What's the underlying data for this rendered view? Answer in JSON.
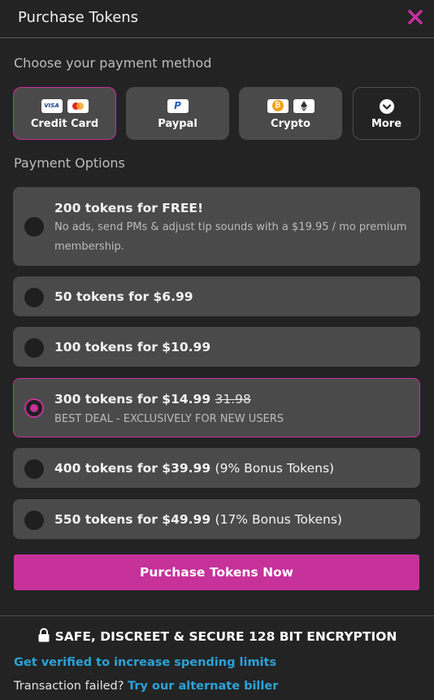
{
  "header": {
    "title": "Purchase Tokens",
    "close_icon": "close-icon"
  },
  "payment_method": {
    "label": "Choose your payment method",
    "methods": [
      {
        "label": "Credit Card",
        "icons": [
          "visa-icon",
          "mastercard-icon"
        ],
        "selected": true
      },
      {
        "label": "Paypal",
        "icons": [
          "paypal-icon"
        ],
        "selected": false
      },
      {
        "label": "Crypto",
        "icons": [
          "bitcoin-icon",
          "ethereum-icon"
        ],
        "selected": false
      },
      {
        "label": "More",
        "icons": [
          "chevron-down-icon"
        ],
        "selected": false
      }
    ],
    "visa_text": "VISA",
    "paypal_text": "P",
    "bitcoin_text": "₿"
  },
  "payment_options": {
    "label": "Payment Options",
    "options": [
      {
        "title": "200 tokens for FREE!",
        "subtitle": "No ads, send PMs & adjust tip sounds with a $19.95 / mo premium membership.",
        "selected": false
      },
      {
        "title": "50 tokens for $6.99",
        "selected": false
      },
      {
        "title": "100 tokens for $10.99",
        "selected": false
      },
      {
        "title": "300 tokens for $14.99",
        "old_price": "31.98",
        "subtitle": "BEST DEAL - EXCLUSIVELY FOR NEW USERS",
        "selected": true
      },
      {
        "title": "400 tokens for $39.99",
        "bonus": "(9% Bonus Tokens)",
        "selected": false
      },
      {
        "title": "550 tokens for $49.99",
        "bonus": "(17% Bonus Tokens)",
        "selected": false
      }
    ]
  },
  "purchase_button": "Purchase Tokens Now",
  "footer": {
    "secure_text": "SAFE, DISCREET & SECURE 128 BIT ENCRYPTION",
    "verify_link": "Get verified to increase spending limits",
    "failed_text": "Transaction failed?",
    "alt_biller_link": "Try our alternate biller"
  },
  "colors": {
    "accent": "#c6319a",
    "background": "#232323",
    "card": "#4a4a4a",
    "link": "#2aa3d8"
  }
}
